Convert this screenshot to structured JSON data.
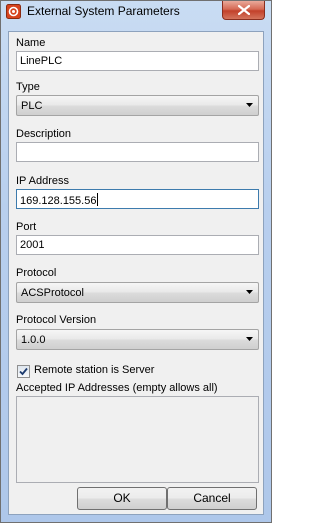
{
  "window": {
    "title": "External System Parameters",
    "close_icon": "close-icon",
    "app_icon": "app-icon"
  },
  "fields": {
    "name": {
      "label": "Name",
      "value": "LinePLC"
    },
    "type": {
      "label": "Type",
      "value": "PLC"
    },
    "description": {
      "label": "Description",
      "value": ""
    },
    "ip_address": {
      "label": "IP Address",
      "value": "169.128.155.56"
    },
    "port": {
      "label": "Port",
      "value": "2001"
    },
    "protocol": {
      "label": "Protocol",
      "value": "ACSProtocol"
    },
    "protocol_version": {
      "label": "Protocol Version",
      "value": "1.0.0"
    }
  },
  "remote_server": {
    "label": "Remote station is Server",
    "checked": true
  },
  "accepted_ips": {
    "label": "Accepted IP Addresses (empty allows all)",
    "value": ""
  },
  "buttons": {
    "ok": "OK",
    "cancel": "Cancel"
  },
  "colors": {
    "close_button": "#c2412b",
    "client_bg": "#f0f0f0",
    "frame": "#b8cfee"
  }
}
